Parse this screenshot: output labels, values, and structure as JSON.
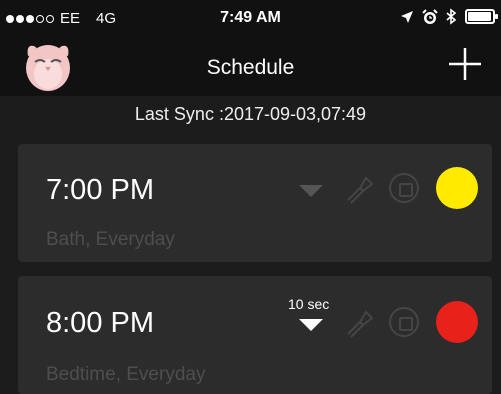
{
  "status_bar": {
    "carrier": "EE",
    "network": "4G",
    "time": "7:49 AM",
    "signal_bars_filled": 3,
    "signal_bars_total": 5,
    "icons": [
      "location-arrow-icon",
      "alarm-icon",
      "bluetooth-icon",
      "battery-icon"
    ],
    "battery_level": 0.95
  },
  "nav": {
    "title": "Schedule",
    "avatar_icon": "owl-avatar-icon",
    "add_icon": "plus-icon"
  },
  "sync": {
    "text": "Last Sync :2017-09-03,07:49"
  },
  "schedules": [
    {
      "time": "7:00 PM",
      "subtitle": "Bath, Everyday",
      "arrow_active": false,
      "duration_label": "",
      "color": "#ffea00"
    },
    {
      "time": "8:00 PM",
      "subtitle": "Bedtime, Everyday",
      "arrow_active": true,
      "duration_label": "10 sec",
      "color": "#e8211a"
    }
  ]
}
